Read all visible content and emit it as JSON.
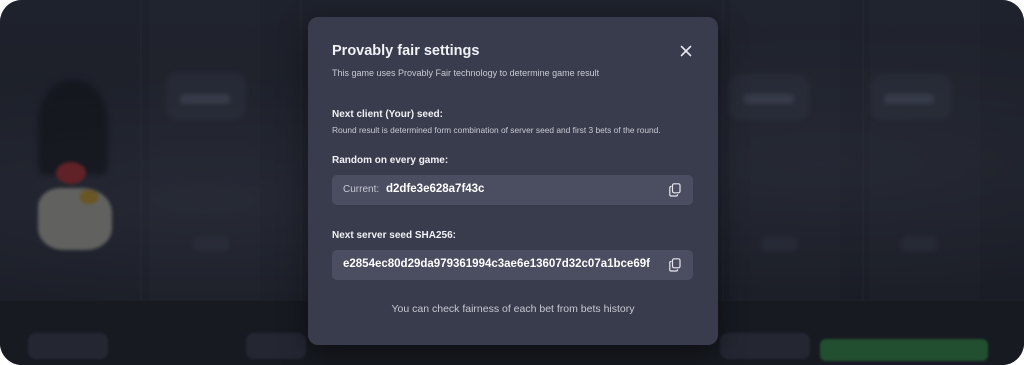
{
  "modal": {
    "title": "Provably fair settings",
    "subtitle": "This game uses Provably Fair technology to determine game result",
    "client_seed": {
      "heading": "Next client (Your) seed:",
      "description": "Round result is determined form combination of server seed and first 3 bets of the round.",
      "mode_heading": "Random on every game:",
      "current_label": "Current:",
      "current_value": "d2dfe3e628a7f43c"
    },
    "server_seed": {
      "heading": "Next server seed SHA256:",
      "value": "e2854ec80d29da979361994c3ae6e13607d32c07a1bce69f"
    },
    "footer_note": "You can check fairness of each bet from bets history"
  },
  "icons": {
    "close": "close-icon",
    "copy": "copy-icon"
  },
  "colors": {
    "modal_bg": "#393c4c",
    "field_bg": "#4b4e60",
    "accent_green": "#2c6f3c"
  }
}
